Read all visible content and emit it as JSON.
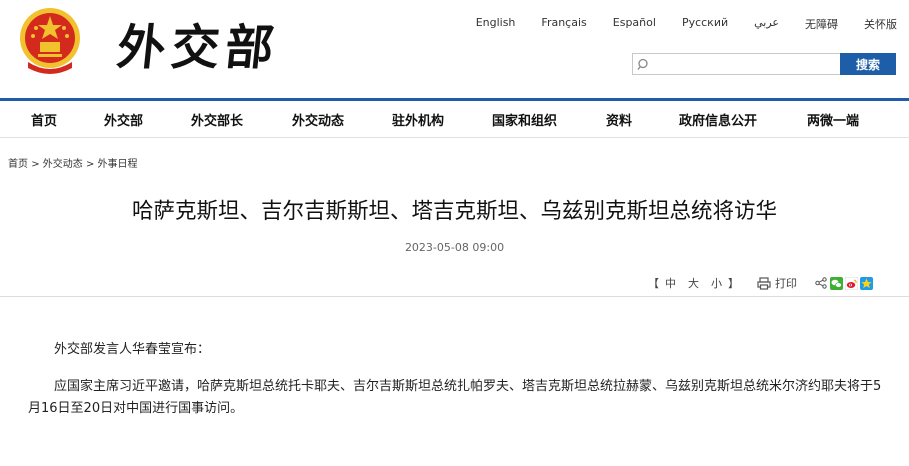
{
  "header": {
    "logo_text": "外交部",
    "languages": [
      "English",
      "Français",
      "Español",
      "Русский",
      "عربي",
      "无障碍",
      "关怀版"
    ],
    "search": {
      "placeholder": "",
      "button_label": "搜索"
    }
  },
  "nav": {
    "items": [
      "首页",
      "外交部",
      "外交部长",
      "外交动态",
      "驻外机构",
      "国家和组织",
      "资料",
      "政府信息公开",
      "两微一端"
    ]
  },
  "breadcrumb": [
    "首页",
    "外交动态",
    "外事日程"
  ],
  "breadcrumb_sep": ">",
  "article": {
    "title": "哈萨克斯坦、吉尔吉斯斯坦、塔吉克斯坦、乌兹别克斯坦总统将访华",
    "date": "2023-05-08 09:00",
    "font_bracket_open": "【",
    "font_sizes": [
      "中",
      "大",
      "小"
    ],
    "font_bracket_close": "】",
    "print_label": "打印",
    "paragraphs": [
      "外交部发言人华春莹宣布：",
      "应国家主席习近平邀请，哈萨克斯坦总统托卡耶夫、吉尔吉斯斯坦总统扎帕罗夫、塔吉克斯坦总统拉赫蒙、乌兹别克斯坦总统米尔济约耶夫将于5月16日至20日对中国进行国事访问。"
    ]
  },
  "colors": {
    "accent": "#1e5ea8",
    "emblem_red": "#d42a1e",
    "emblem_gold": "#f2c12e"
  },
  "icons": [
    "search-icon",
    "printer-icon",
    "share-icon",
    "wechat-icon",
    "weibo-icon",
    "qzone-icon"
  ]
}
